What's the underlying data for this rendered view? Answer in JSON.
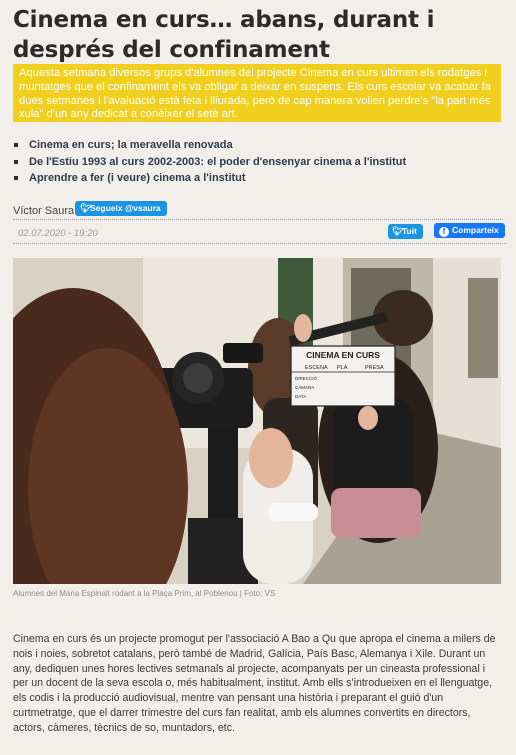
{
  "article": {
    "title": "Cinema en curs… abans, durant i després del confinament",
    "lead": "Aquesta setmana diversos grups d'alumnes del projecte Cinema en curs ultimen els rodatges i muntatges que el confinament els va obligar a deixar en suspens. Els curs escolar va acabar fa dues setmanes i l'avaluació està feta i lliurada, però de cap manera volien perdre's \"la part més xula\" d'un any dedicat a conèixer el setè art.",
    "related": [
      "Cinema en curs; la meravella renovada",
      "De l'Estiu 1993 al curs 2002-2003: el poder d'ensenyar cinema a l'institut",
      "Aprendre a fer (i veure) cinema a l'institut"
    ],
    "author": "Víctor Saura",
    "follow_label": "Segueix @vsaura",
    "date": "02.07.2020 - 19:20",
    "share": {
      "tweet_label": "Tuit",
      "facebook_label": "Comparteix"
    },
    "photo": {
      "caption": "Alumnes del Maria Espinalt rodant a la Plaça Prim, al Poblenou | Foto: VS",
      "clapper_title": "CINEMA EN CURS",
      "clapper_cols": [
        "ESCENA",
        "PLA",
        "PRESA"
      ],
      "clapper_rows": [
        "DIRECCIÓ",
        "CÀMARA",
        "DATA"
      ]
    },
    "body": "Cinema en curs és un projecte promogut per l'associació A Bao a Qu que apropa el cinema a milers de nois i noies, sobretot catalans, però també de Madrid, Galícia, País Basc, Alemanya i Xile. Durant un any, dediquen unes hores lectives setmanals al projecte, acompanyats per un cineasta professional i per un docent de la seva escola o, més habitualment, institut. Amb ells s'introdueixen en el llenguatge, els codis i la producció audiovisual, mentre van pensant una història i preparant el guió d'un curtmetratge, que el darrer trimestre del curs fan realitat, amb els alumnes convertits en directors, actors, càmeres, tècnics de so, muntadors, etc."
  },
  "colors": {
    "lead_background": "#f0cf1e",
    "twitter": "#1b95e0",
    "facebook": "#1877f2",
    "page_background": "#f2efea"
  },
  "icons": [
    "twitter-bird-icon",
    "facebook-icon"
  ]
}
